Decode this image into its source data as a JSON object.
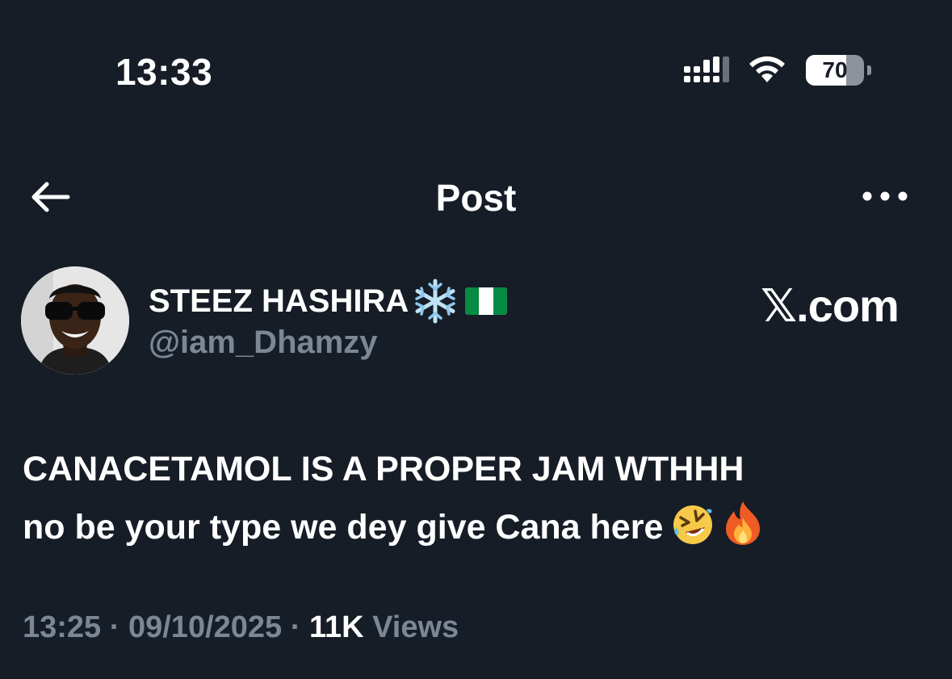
{
  "status_bar": {
    "time": "13:33",
    "battery_level": "70",
    "battery_fraction": 0.7,
    "signal_icon": "cellular-signal-icon",
    "wifi_icon": "wifi-icon"
  },
  "header": {
    "title": "Post",
    "back_icon": "back-arrow-icon",
    "more_icon": "more-options-icon"
  },
  "author": {
    "display_name": "STEEZ HASHIRA",
    "badges": [
      "snowflake-emoji",
      "nigeria-flag-emoji"
    ],
    "handle": "@iam_Dhamzy"
  },
  "watermark": "𝕏.com",
  "post": {
    "line1": "CANACETAMOL IS A PROPER JAM WTHHH",
    "line2": "no be your type we dey give Cana here",
    "emojis": [
      "rolling-laughing-emoji",
      "fire-emoji"
    ]
  },
  "meta": {
    "time": "13:25",
    "separator": " · ",
    "date": "09/10/2025",
    "views_count": "11K",
    "views_label": " Views"
  },
  "colors": {
    "background": "#161d27",
    "text": "#ffffff",
    "muted": "#7b8794"
  }
}
